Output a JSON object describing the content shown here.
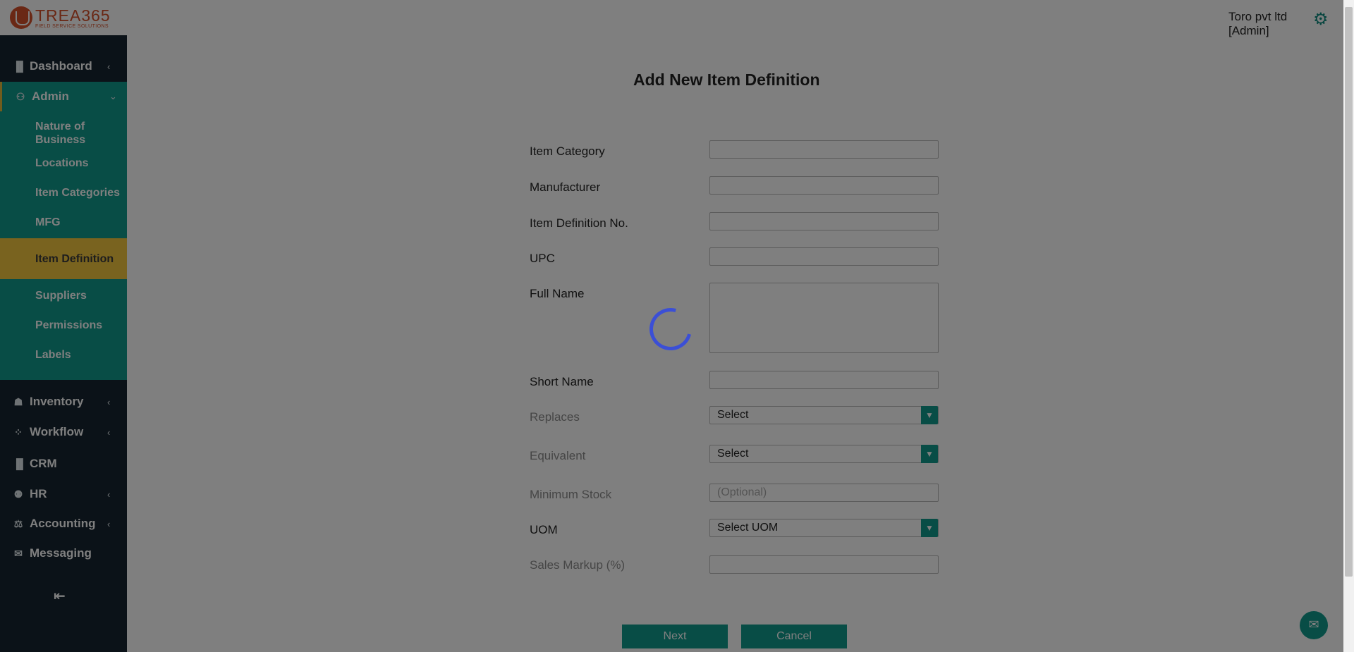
{
  "header": {
    "logo_title": "TREA365",
    "logo_subtitle": "FIELD SERVICE SOLUTIONS",
    "user_company": "Toro pvt ltd",
    "user_role": "[Admin]",
    "settings_icon": "gear-icon"
  },
  "sidebar": {
    "items": [
      {
        "label": "Dashboard",
        "icon": "bar-chart-icon",
        "chevron": "‹"
      },
      {
        "label": "Admin",
        "icon": "user-admin-icon",
        "chevron": "⌄"
      },
      {
        "label": "Inventory",
        "icon": "home-icon",
        "chevron": "‹"
      },
      {
        "label": "Workflow",
        "icon": "workflow-icon",
        "chevron": "‹"
      },
      {
        "label": "CRM",
        "icon": "bar-chart-icon"
      },
      {
        "label": "HR",
        "icon": "people-icon",
        "chevron": "‹"
      },
      {
        "label": "Accounting",
        "icon": "scale-icon",
        "chevron": "‹"
      },
      {
        "label": "Messaging",
        "icon": "chat-icon"
      }
    ],
    "admin_subitems": [
      "Nature of Business",
      "Locations",
      "Item Categories",
      "MFG",
      "Item Definition",
      "Suppliers",
      "Permissions",
      "Labels"
    ],
    "active_subitem": "Item Definition",
    "collapse_icon": "collapse-left-icon"
  },
  "form": {
    "title": "Add New Item Definition",
    "labels": {
      "item_category": "Item Category",
      "manufacturer": "Manufacturer",
      "item_definition_no": "Item Definition No.",
      "upc": "UPC",
      "full_name": "Full Name",
      "short_name": "Short Name",
      "replaces": "Replaces",
      "equivalent": "Equivalent",
      "minimum_stock": "Minimum Stock",
      "uom": "UOM",
      "sales_markup": "Sales Markup (%)"
    },
    "values": {
      "replaces": "Select",
      "equivalent": "Select",
      "uom": "Select UOM"
    },
    "placeholders": {
      "minimum_stock": "(Optional)"
    },
    "buttons": {
      "next": "Next",
      "cancel": "Cancel"
    }
  },
  "colors": {
    "sidebar_bg": "#172530",
    "accent": "#109a8d",
    "active_item": "#f3c63f",
    "brand": "#d4502a",
    "spinner": "#3b4fd6"
  },
  "overlay": {
    "loading": true
  }
}
